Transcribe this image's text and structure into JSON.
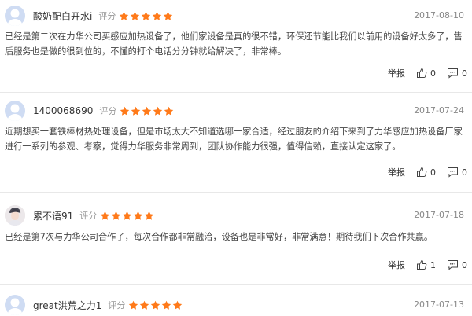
{
  "reviews": [
    {
      "username": "酸奶配白开水i",
      "score_label": "评分",
      "rating": 5,
      "date": "2017-08-10",
      "content": "已经是第二次在力华公司买感应加热设备了，他们家设备是真的很不错，环保还节能比我们以前用的设备好太多了，售后服务也是做的很到位的，不懂的打个电话分分钟就给解决了，非常棒。",
      "report_label": "举报",
      "like_count": "0",
      "comment_count": "0",
      "avatar": "default-avatar"
    },
    {
      "username": "1400068690",
      "score_label": "评分",
      "rating": 5,
      "date": "2017-07-24",
      "content": "近期想买一套铁棒材热处理设备，但是市场太大不知道选哪一家合适，经过朋友的介绍下来到了力华感应加热设备厂家进行一系列的参观、考察，觉得力华服务非常周到，团队协作能力很强，值得信赖，直接认定这家了。",
      "report_label": "举报",
      "like_count": "0",
      "comment_count": "0",
      "avatar": "default-avatar"
    },
    {
      "username": "累不语91",
      "score_label": "评分",
      "rating": 5,
      "date": "2017-07-18",
      "content": "已经是第7次与力华公司合作了，每次合作都非常融洽，设备也是非常好，非常满意！期待我们下次合作共赢。",
      "report_label": "举报",
      "like_count": "1",
      "comment_count": "0",
      "avatar": "photo-avatar"
    },
    {
      "username": "great洪荒之力1",
      "score_label": "评分",
      "rating": 5,
      "date": "2017-07-13",
      "content": "",
      "report_label": "",
      "like_count": "",
      "comment_count": "",
      "avatar": "default-avatar"
    }
  ],
  "colors": {
    "star": "#ff7a1a",
    "avatar_bg": "#cfdcf3",
    "avatar_person": "#ffffff",
    "divider": "#e8e8e8"
  }
}
